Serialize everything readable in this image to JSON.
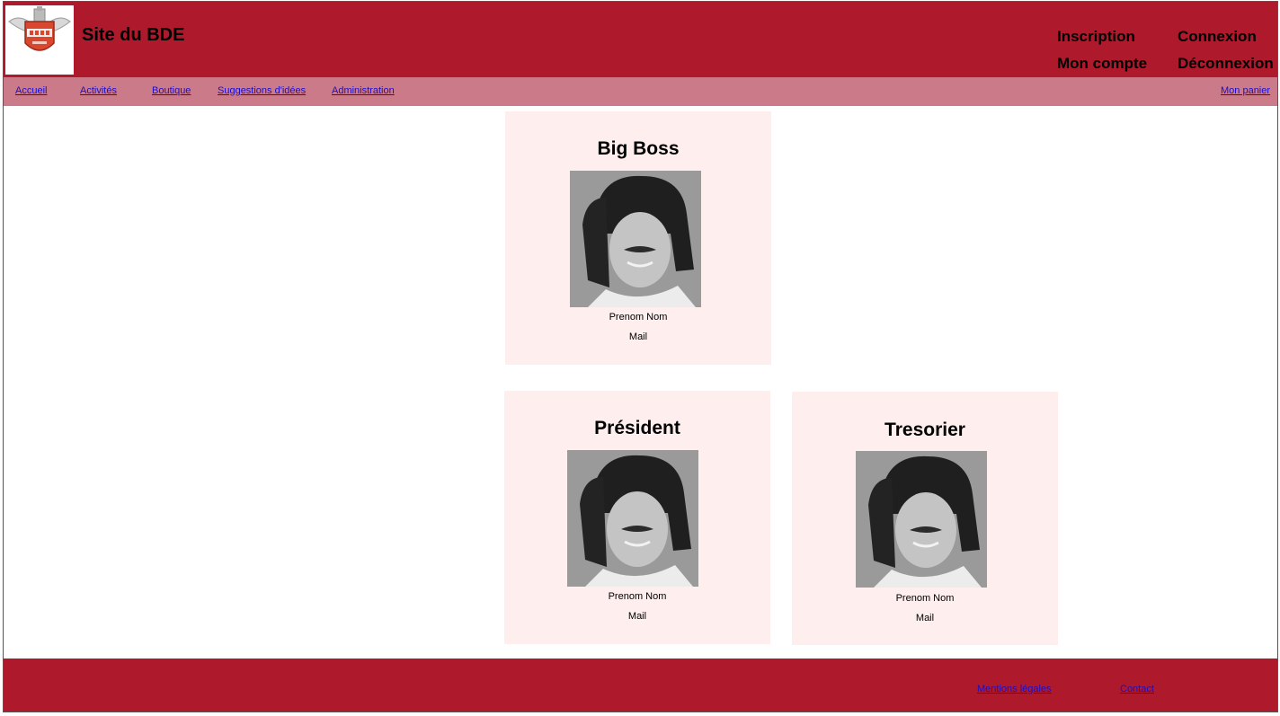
{
  "header": {
    "site_title": "Site du BDE",
    "logo_icon": "exia-logo-icon",
    "auth": {
      "inscription": "Inscription",
      "connexion": "Connexion",
      "mon_compte": "Mon compte",
      "deconnexion": "Déconnexion"
    }
  },
  "nav": {
    "items": [
      "Accueil",
      "Activités",
      "Boutique",
      "Suggestions d'idées",
      "Administration"
    ],
    "cart": "Mon panier"
  },
  "cards": [
    {
      "role": "Big Boss",
      "name": "Prenom Nom",
      "mail": "Mail"
    },
    {
      "role": "Président",
      "name": "Prenom Nom",
      "mail": "Mail"
    },
    {
      "role": "Tresorier",
      "name": "Prenom Nom",
      "mail": "Mail"
    }
  ],
  "footer": {
    "mentions": "Mentions légales",
    "contact": "Contact"
  },
  "colors": {
    "header_red": "#ae1a2c",
    "nav_pink": "#cb7a8a",
    "card_bg": "#feeeee",
    "link_blue": "#1a0dcc"
  }
}
